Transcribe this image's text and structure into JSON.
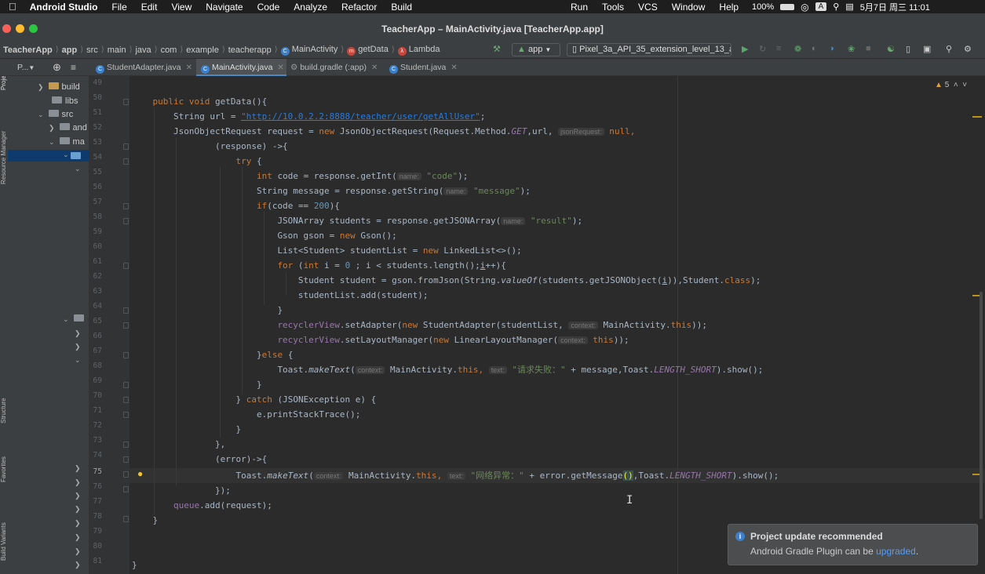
{
  "menubar": {
    "app": "Android Studio",
    "items": [
      "File",
      "Edit",
      "View",
      "Navigate",
      "Code",
      "Analyze",
      "Refactor",
      "Build"
    ],
    "right_items": [
      "Run",
      "Tools",
      "VCS",
      "Window",
      "Help"
    ],
    "battery": "100%",
    "input": "A",
    "datetime": "5月7日 周三 11:01"
  },
  "window": {
    "title": "TeacherApp – MainActivity.java [TeacherApp.app]"
  },
  "navbar": {
    "crumbs": [
      "TeacherApp",
      "app",
      "src",
      "main",
      "java",
      "com",
      "example",
      "teacherapp",
      "MainActivity",
      "getData",
      "Lambda"
    ],
    "run_config": "app",
    "device": "Pixel_3a_API_35_extension_level_13_a"
  },
  "tabs": {
    "project_label": "P...",
    "files": [
      "StudentAdapter.java",
      "MainActivity.java",
      "build.gradle (:app)",
      "Student.java"
    ]
  },
  "sidebar": {
    "labels": [
      "Project",
      "Resource Manager",
      "Structure",
      "Favorites",
      "Build Variants"
    ]
  },
  "tree": {
    "items": [
      "build",
      "libs",
      "src",
      "and",
      "ma"
    ]
  },
  "editor": {
    "warnings": "5",
    "line_numbers": [
      "49",
      "50",
      "51",
      "52",
      "53",
      "54",
      "55",
      "56",
      "57",
      "58",
      "59",
      "60",
      "61",
      "62",
      "63",
      "64",
      "65",
      "66",
      "67",
      "68",
      "69",
      "70",
      "71",
      "72",
      "73",
      "74",
      "75",
      "76",
      "77",
      "78",
      "79",
      "80",
      "81"
    ],
    "current_line": "75",
    "code": {
      "l50": {
        "kw": "public void ",
        "name": "getData",
        "rest": "(){"
      },
      "l51": {
        "pre": "String url = ",
        "str": "\"http://10.0.2.2:8888/teacher/user/getAllUser\"",
        "post": ";"
      },
      "l52": {
        "pre": "JsonObjectRequest request = ",
        "kw": "new",
        "mid": " JsonObjectRequest(Request.Method.",
        "fld": "GET",
        "mid2": ",url, ",
        "hint": "jsonRequest:",
        "kw2": " null",
        "post": ","
      },
      "l53": {
        "text": "(response) ->{"
      },
      "l54": {
        "kw": "try",
        "post": " {"
      },
      "l55": {
        "kw": "int",
        "pre": " code = response.getInt(",
        "hint": "name:",
        "str": " \"code\"",
        "post": ");"
      },
      "l56": {
        "pre": "String message = response.getString(",
        "hint": "name:",
        "str": " \"message\"",
        "post": ");"
      },
      "l57": {
        "kw": "if",
        "pre": "(code == ",
        "num": "200",
        "post": "){"
      },
      "l58": {
        "pre": "JSONArray students = response.getJSONArray(",
        "hint": "name:",
        "str": " \"result\"",
        "post": ");"
      },
      "l59": {
        "pre": "Gson gson = ",
        "kw": "new",
        "post": " Gson();"
      },
      "l60": {
        "pre": "List<Student> studentList = ",
        "kw": "new",
        "post": " LinkedList<>();"
      },
      "l61": {
        "kw": "for",
        "pre": " (",
        "kw2": "int",
        "mid": " i = ",
        "num": "0",
        "mid2": " ; i < students.length();",
        "var": "i",
        "post": "++){"
      },
      "l62": {
        "pre": "Student student = gson.fromJson(String.",
        "it": "valueOf",
        "mid": "(students.getJSONObject(",
        "var": "i",
        "mid2": ")),Student.",
        "kw": "class",
        "post": ");"
      },
      "l63": {
        "text": "studentList.add(student);"
      },
      "l64": {
        "text": "}"
      },
      "l65": {
        "fld": "recyclerView",
        "pre": ".setAdapter(",
        "kw": "new",
        "mid": " StudentAdapter(studentList, ",
        "hint": "context:",
        "mid2": " MainActivity.",
        "kw2": "this",
        "post": "));"
      },
      "l66": {
        "fld": "recyclerView",
        "pre": ".setLayoutManager(",
        "kw": "new",
        "mid": " LinearLayoutManager(",
        "hint": "context:",
        "kw2": " this",
        "post": "));"
      },
      "l67": {
        "pre": "}",
        "kw": "else",
        "post": " {"
      },
      "l68": {
        "pre": "Toast.",
        "it": "makeText",
        "mid": "(",
        "hint": "context:",
        "mid2": " MainActivity.",
        "kw": "this",
        "mid3": ", ",
        "hint2": "text:",
        "str": " \"请求失败：\"",
        "mid4": " + message,Toast.",
        "fld": "LENGTH_SHORT",
        "post": ").show();"
      },
      "l69": {
        "text": "}"
      },
      "l70": {
        "pre": "} ",
        "kw": "catch",
        "post": " (JSONException e) {"
      },
      "l71": {
        "text": "e.printStackTrace();"
      },
      "l72": {
        "text": "}"
      },
      "l73": {
        "text": "},"
      },
      "l74": {
        "text": "(error)->{"
      },
      "l75": {
        "pre": "Toast.",
        "it": "makeText",
        "mid": "(",
        "hint": "context:",
        "mid2": " MainActivity.",
        "kw": "this",
        "mid3": ", ",
        "hint2": "text:",
        "str": " \"网络异常：\"",
        "mid4": " + error.getMessage",
        "paren": "()",
        "mid5": ",Toast.",
        "fld": "LENGTH_SHORT",
        "post": ").show();"
      },
      "l76": {
        "text": "});"
      },
      "l77": {
        "fld": "queue",
        "post": ".add(request);"
      },
      "l78": {
        "text": "}"
      },
      "l81": {
        "text": "}"
      }
    }
  },
  "notification": {
    "title": "Project update recommended",
    "body": "Android Gradle Plugin can be ",
    "link": "upgraded",
    "tail": "."
  },
  "colors": {
    "keyword": "#cc7832",
    "string": "#6a8759",
    "field": "#9876aa",
    "number": "#6897bb",
    "link": "#287bde",
    "background": "#2b2b2b"
  }
}
